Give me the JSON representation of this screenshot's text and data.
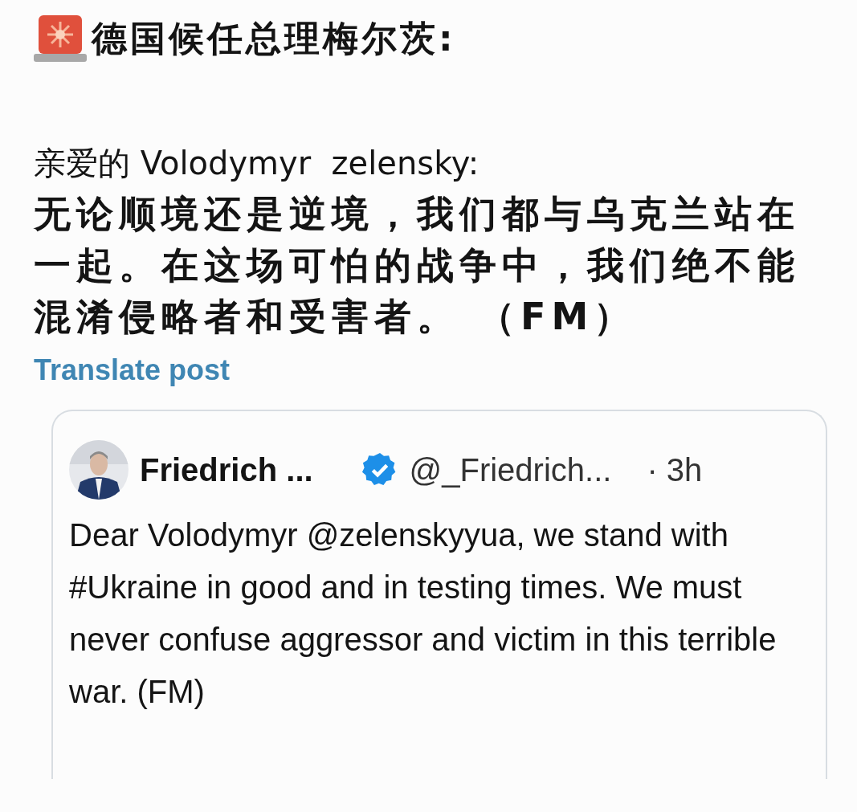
{
  "post": {
    "headline": "德国候任总理梅尔茨:",
    "greeting": "亲爱的 Volodymyr  zelensky:",
    "message": "无论顺境还是逆境，我们都与乌克兰站在一起。在这场可怕的战争中，我们绝不能混淆侵略者和受害者。 （FM）",
    "translate_link": "Translate post"
  },
  "quoted_post": {
    "name": "Friedrich ...",
    "verified": true,
    "handle": "@_Friedrich...",
    "time": "· 3h",
    "text": "Dear Volodymyr @zelenskyyua, we stand with #Ukraine in good and in testing times. We must never confuse aggressor and victim in this terrible war. (FM)"
  }
}
